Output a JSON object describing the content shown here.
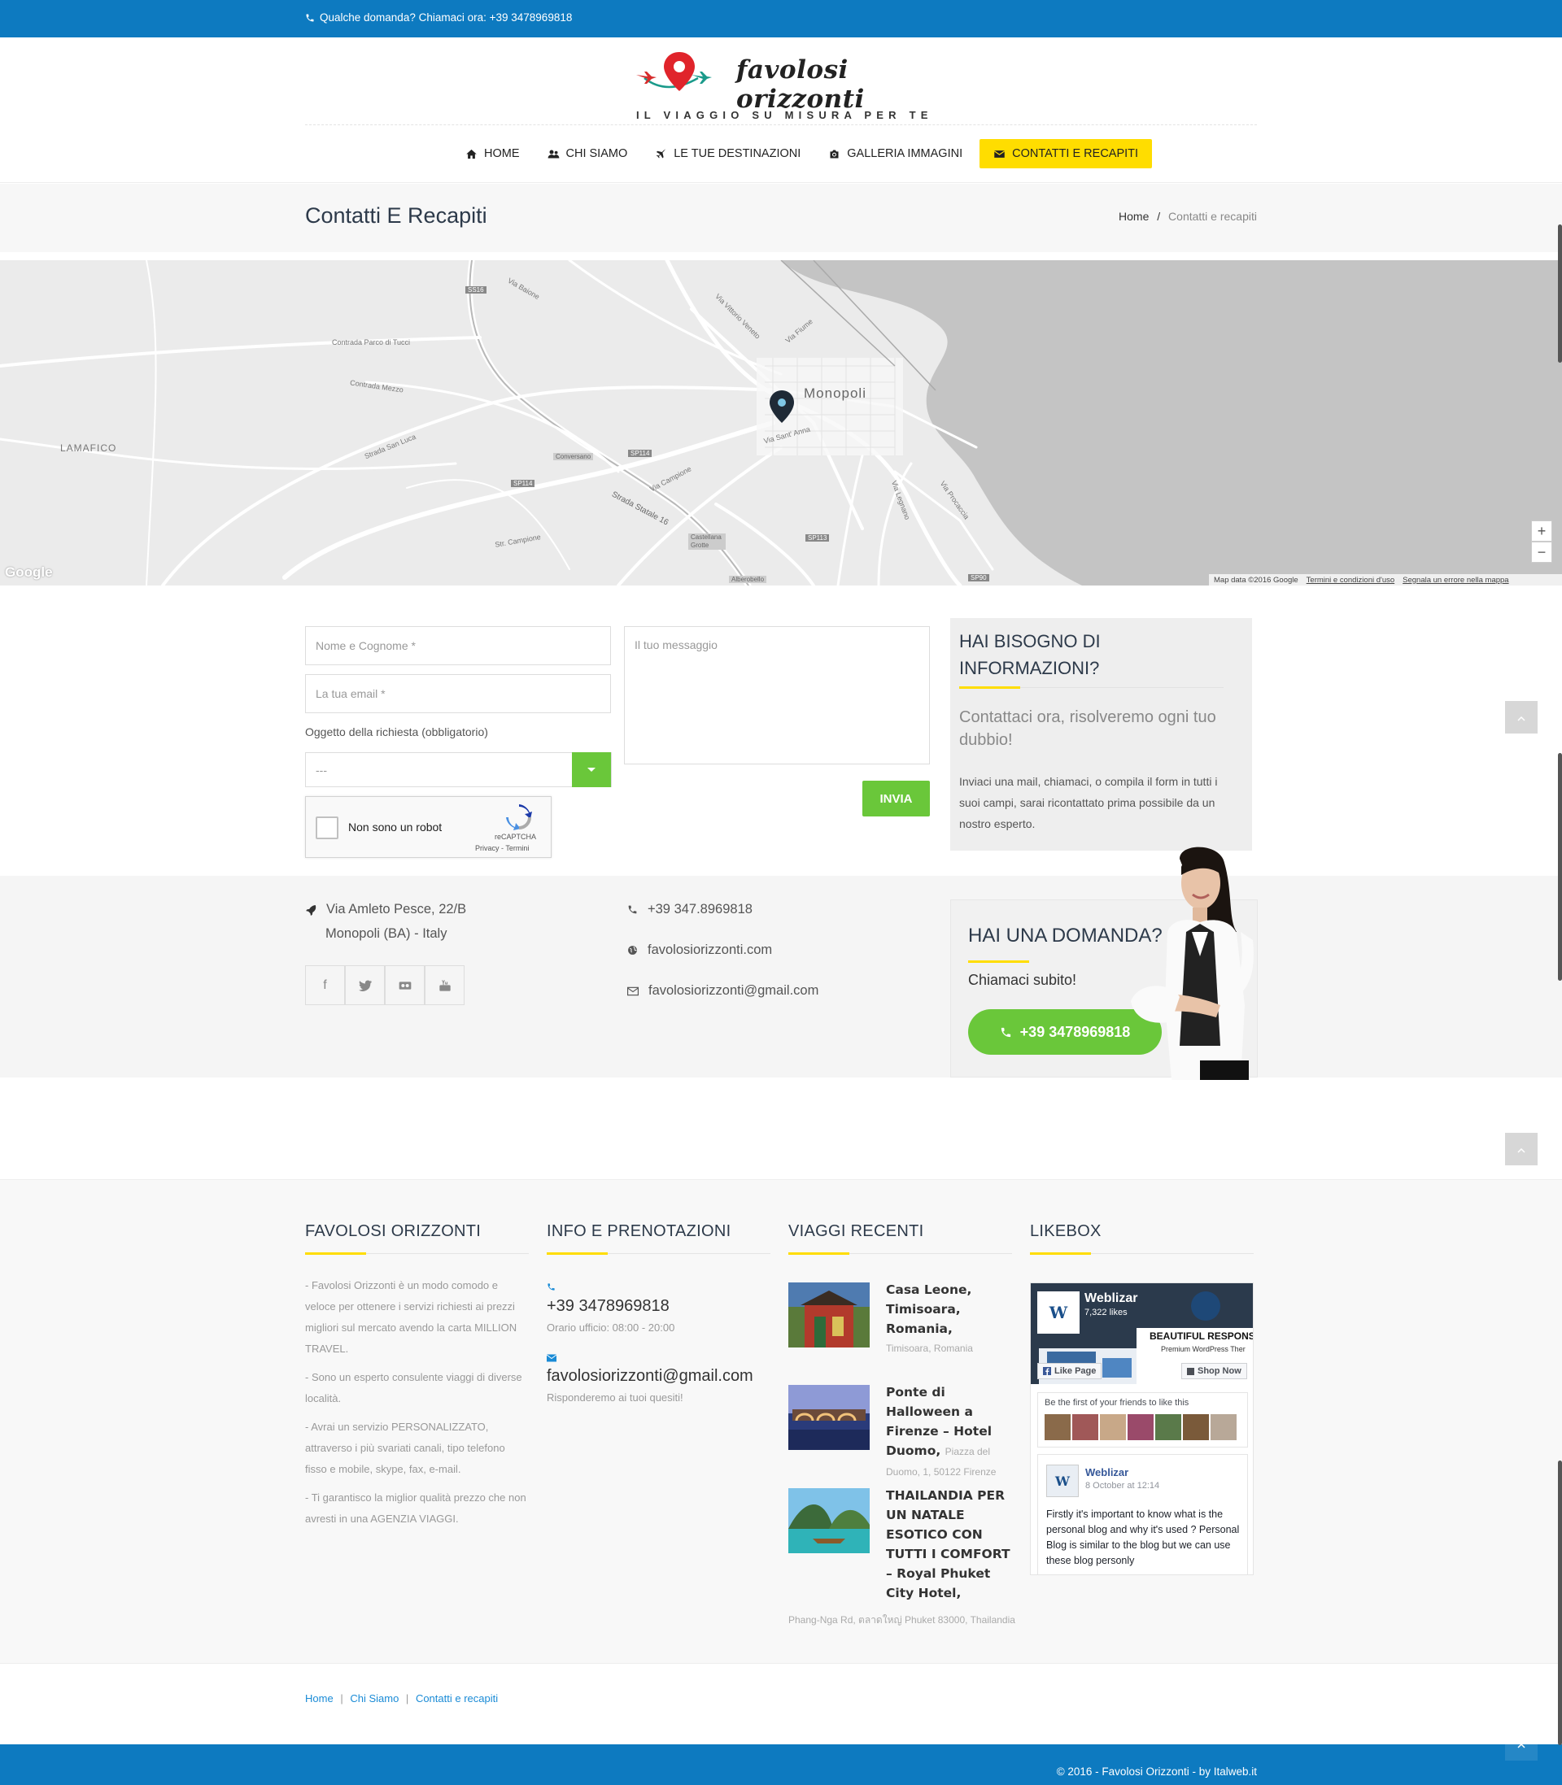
{
  "topbar": {
    "phone_text": "Qualche domanda? Chiamaci ora: +39 3478969818"
  },
  "logo": {
    "brand": "favolosi orizzonti",
    "tagline": "IL VIAGGIO SU MISURA PER TE"
  },
  "nav": [
    {
      "label": "HOME",
      "icon": "home-icon"
    },
    {
      "label": "CHI SIAMO",
      "icon": "users-icon"
    },
    {
      "label": "LE TUE DESTINAZIONI",
      "icon": "plane-icon"
    },
    {
      "label": "GALLERIA IMMAGINI",
      "icon": "camera-icon"
    },
    {
      "label": "CONTATTI E RECAPITI",
      "icon": "envelope-icon",
      "active": true
    }
  ],
  "page": {
    "title": "Contatti E Recapiti",
    "breadcrumb_home": "Home",
    "breadcrumb_sep": "/",
    "breadcrumb_current": "Contatti e recapiti"
  },
  "map": {
    "city": "Monopoli",
    "place_lamafico": "LAMAFICO",
    "attribution": "Map data ©2016 Google",
    "terms": "Termini e condizioni d'uso",
    "report": "Segnala un errore nella mappa",
    "google": "Google",
    "labels": {
      "ss16": "SS16",
      "sp114a": "SP114",
      "sp114b": "SP114",
      "sp113": "SP113",
      "sp90": "SP90",
      "via_baione": "Via Baione",
      "contrada_parco": "Contrada Parco di Tucci",
      "contrada_mezzo": "Contrada Mezzo",
      "strada_statale": "Strada Statale 16",
      "via_sant_anna": "Via Sant' Anna",
      "via_procaccia": "Via Procaccia",
      "via_vittorio_veneto": "Via Vittorio Veneto",
      "via_fiume": "Via Fiume",
      "via_campione": "Via Campione",
      "conversano": "Conversano",
      "castellana": "Castellana Grotte",
      "alberobello": "Alberobello",
      "via_legnano": "Via Legnano",
      "strada_san_luca": "Strada San Luca",
      "str_campione": "Str. Campione"
    },
    "zoom_in": "+",
    "zoom_out": "−"
  },
  "form": {
    "name_placeholder": "Nome e Cognome *",
    "email_placeholder": "La tua email *",
    "subject_label": "Oggetto della richiesta (obbligatorio)",
    "subject_value": "---",
    "message_placeholder": "Il tuo messaggio",
    "captcha_label": "Non sono un robot",
    "captcha_brand": "reCAPTCHA",
    "captcha_links": "Privacy - Termini",
    "submit": "INVIA"
  },
  "info_box": {
    "heading": "HAI BISOGNO DI INFORMAZIONI?",
    "subheading": "Contattaci ora, risolveremo ogni tuo dubbio!",
    "body": "Inviaci una mail, chiamaci, o compila il form in tutti i suoi campi, sarai ricontattato prima possibile da un nostro esperto."
  },
  "address": {
    "line1": "Via Amleto Pesce, 22/B",
    "line2": "Monopoli (BA) - Italy",
    "phone": "+39 347.8969818",
    "website": "favolosiorizzonti.com",
    "email": "favolosiorizzonti@gmail.com"
  },
  "question_box": {
    "heading": "HAI UNA DOMANDA?",
    "sub": "Chiamaci subito!",
    "button": "+39 3478969818"
  },
  "footer": {
    "col1": {
      "title": "FAVOLOSI ORIZZONTI",
      "p1": "- Favolosi Orizzonti è un modo comodo e veloce per ottenere i servizi richiesti ai prezzi migliori sul mercato avendo la carta MILLION TRAVEL.",
      "p2": "- Sono un esperto consulente viaggi di diverse località.",
      "p3": "- Avrai un servizio PERSONALIZZATO, attraverso i più svariati canali, tipo telefono fisso e mobile, skype, fax, e-mail.",
      "p4": "- Ti garantisco la miglior qualità prezzo che non avresti in una AGENZIA VIAGGI."
    },
    "col2": {
      "title": "INFO E PRENOTAZIONI",
      "phone": "+39 3478969818",
      "hours": "Orario ufficio: 08:00 - 20:00",
      "email": "favolosiorizzonti@gmail.com",
      "reply": "Risponderemo ai tuoi quesiti!"
    },
    "col3": {
      "title": "VIAGGI RECENTI",
      "trips": [
        {
          "title": "Casa Leone, Timisoara, Romania,",
          "loc": "Timisoara, Romania"
        },
        {
          "title": "Ponte di Halloween a Firenze – Hotel Duomo,",
          "loc": "Piazza del Duomo, 1, 50122 Firenze"
        },
        {
          "title": "THAILANDIA PER UN NATALE ESOTICO CON TUTTI I COMFORT – Royal Phuket City Hotel,",
          "loc": "Phang-Nga Rd, ตลาดใหญ่ Phuket 83000, Thailandia"
        }
      ]
    },
    "col4": {
      "title": "LIKEBOX",
      "page_name": "Weblizar",
      "likes": "7,322 likes",
      "banner_text": "BEAUTIFUL RESPONSI",
      "banner_sub": "Premium WordPress Ther",
      "like_page": "Like Page",
      "shop_now": "Shop Now",
      "friends_text": "Be the first of your friends to like this",
      "post_author": "Weblizar",
      "post_date": "8 October at 12:14",
      "post_text": "Firstly it's important to know what is the personal blog and why it's used ? Personal Blog is similar to the blog but we can use these blog personly"
    }
  },
  "subfooter": {
    "link1": "Home",
    "link2": "Chi Siamo",
    "link3": "Contatti e recapiti",
    "sep": "|"
  },
  "copyright": "© 2016 - Favolosi Orizzonti - by Italweb.it",
  "colors": {
    "blue": "#0d7ac0",
    "yellow": "#ffdd00",
    "green": "#6ac73a"
  }
}
